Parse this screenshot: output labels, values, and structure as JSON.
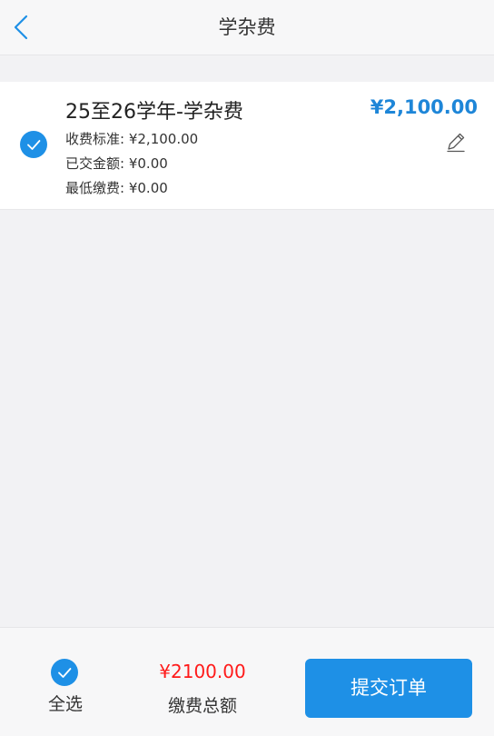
{
  "header": {
    "title": "学杂费",
    "back_icon": "chevron-left-icon"
  },
  "fee_item": {
    "selected": true,
    "title": "25至26学年-学杂费",
    "amount": "¥2,100.00",
    "details": [
      {
        "label": "收费标准:",
        "value": "¥2,100.00"
      },
      {
        "label": "已交金额:",
        "value": "¥0.00"
      },
      {
        "label": "最低缴费:",
        "value": "¥0.00"
      }
    ],
    "edit_icon": "pencil-icon"
  },
  "footer": {
    "select_all_label": "全选",
    "select_all_checked": true,
    "total_amount": "¥2100.00",
    "total_label": "缴费总额",
    "submit_label": "提交订单"
  },
  "colors": {
    "accent": "#1e90e6",
    "amount_blue": "#1e86d8",
    "total_red": "#ff1a1a",
    "background": "#f2f2f4"
  }
}
